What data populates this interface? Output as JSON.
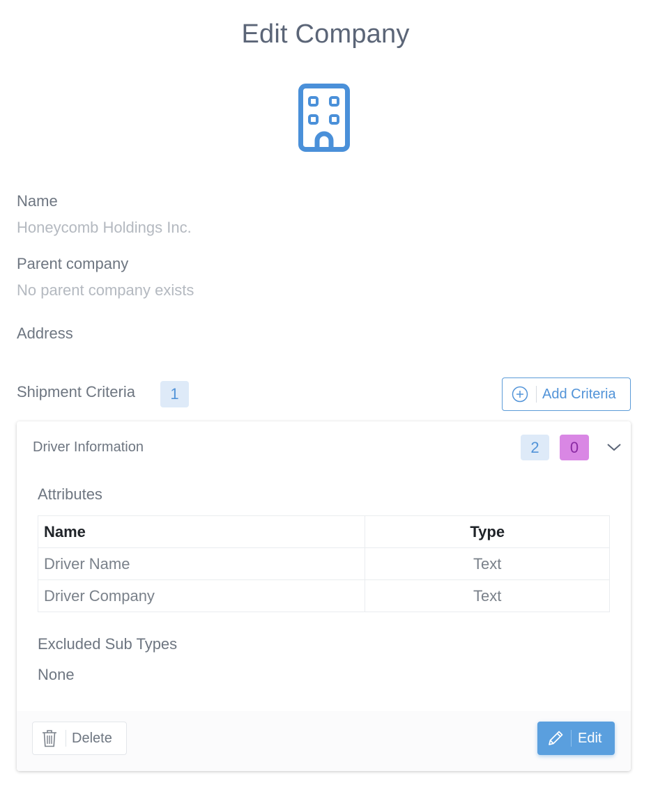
{
  "page": {
    "title": "Edit Company"
  },
  "company": {
    "icon": "building-icon",
    "name_label": "Name",
    "name_value": "Honeycomb Holdings Inc.",
    "parent_label": "Parent company",
    "parent_value": "No parent company exists",
    "address_label": "Address"
  },
  "shipment_criteria": {
    "label": "Shipment Criteria",
    "count": "1",
    "add_button": {
      "label": "Add Criteria",
      "icon": "plus-circle-icon"
    }
  },
  "criteria_card": {
    "title": "Driver Information",
    "attribute_count": "2",
    "excluded_count": "0",
    "expand_icon": "chevron-down-icon",
    "attributes_label": "Attributes",
    "table": {
      "headers": [
        "Name",
        "Type"
      ],
      "rows": [
        [
          "Driver Name",
          "Text"
        ],
        [
          "Driver Company",
          "Text"
        ]
      ]
    },
    "excluded_label": "Excluded Sub Types",
    "excluded_value": "None",
    "delete_button": {
      "label": "Delete",
      "icon": "trash-icon"
    },
    "edit_button": {
      "label": "Edit",
      "icon": "pencil-icon"
    }
  },
  "colors": {
    "accent": "#4a90d9",
    "badge_blue_bg": "#deeaf8",
    "badge_purple_bg": "#d987e4",
    "edit_button_bg": "#5a9fde"
  }
}
